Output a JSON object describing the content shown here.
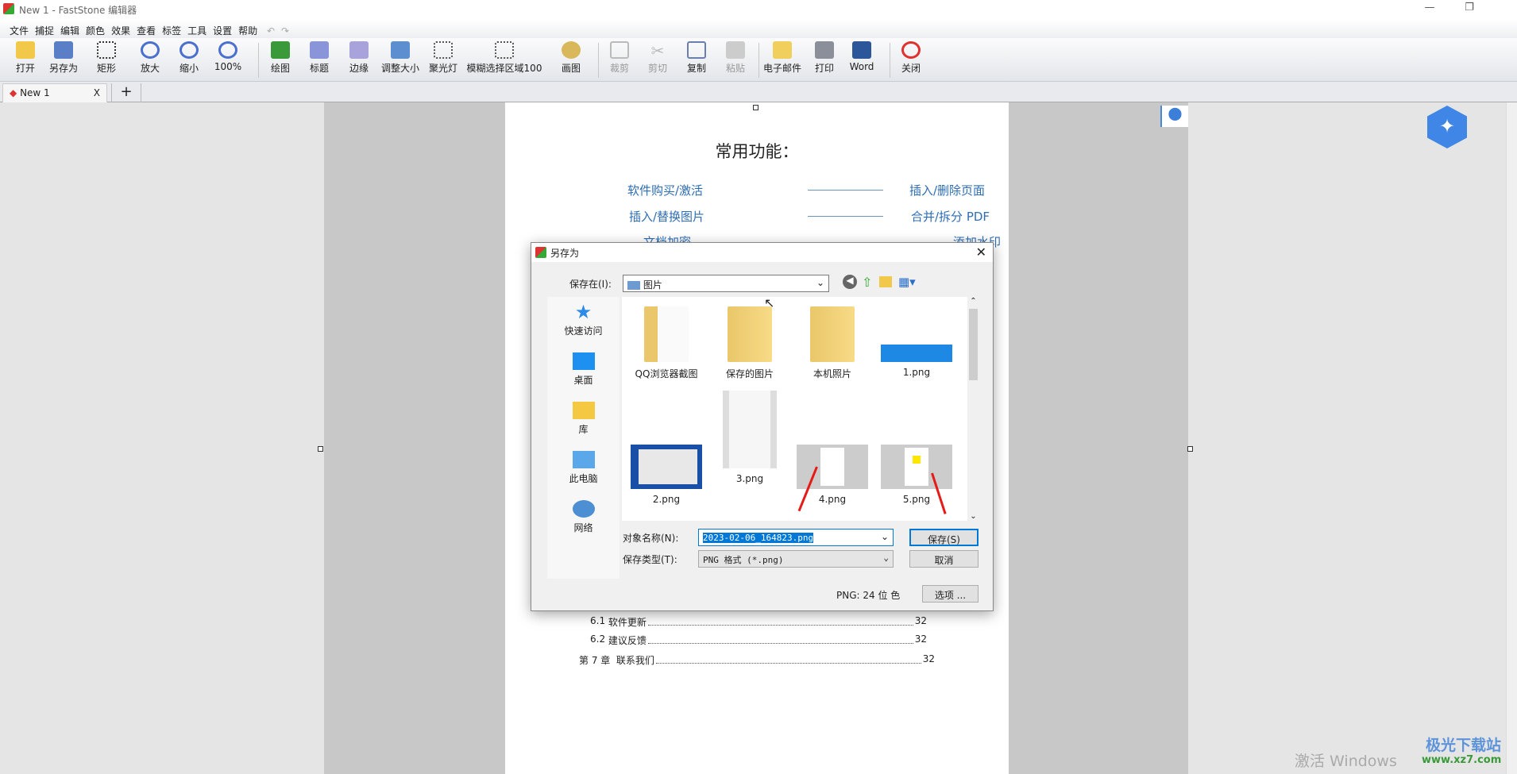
{
  "window": {
    "title": "New 1 - FastStone 编辑器",
    "min": "—",
    "restore": "❐"
  },
  "menu": [
    "文件",
    "捕捉",
    "编辑",
    "颜色",
    "效果",
    "查看",
    "标签",
    "工具",
    "设置",
    "帮助"
  ],
  "toolbar": {
    "open": "打开",
    "save_as": "另存为",
    "rect": "矩形",
    "zoom_in": "放大",
    "zoom_out": "缩小",
    "zoom": "100%",
    "draw": "绘图",
    "caption": "标题",
    "edge": "边缘",
    "resize": "调整大小",
    "spotlight": "聚光灯",
    "blur": "模糊选择区域100",
    "paint": "画图",
    "crop": "裁剪",
    "cut": "剪切",
    "copy": "复制",
    "paste": "粘贴",
    "email": "电子邮件",
    "print": "打印",
    "word": "Word",
    "close": "关闭"
  },
  "tabs": [
    {
      "label": "New 1",
      "close": "X"
    }
  ],
  "add_tab": "+",
  "document": {
    "heading": "常用功能：",
    "links": [
      {
        "left": "软件购买/激活",
        "right": "插入/删除页面"
      },
      {
        "left": "插入/替换图片",
        "right": "合并/拆分 PDF"
      },
      {
        "left": "文档加密",
        "right": "添加水印"
      }
    ],
    "toc": [
      {
        "num": "6.1",
        "title": "软件更新",
        "page": "32"
      },
      {
        "num": "6.2",
        "title": "建议反馈",
        "page": "32"
      },
      {
        "num": "第 7 章",
        "title": "联系我们",
        "page": "32"
      }
    ]
  },
  "dialog": {
    "title": "另存为",
    "close": "✕",
    "save_in_label": "保存在(I):",
    "save_in_value": "图片",
    "places": [
      "快速访问",
      "桌面",
      "库",
      "此电脑",
      "网络"
    ],
    "files": [
      "QQ浏览器截图",
      "保存的图片",
      "本机照片",
      "1.png",
      "2.png",
      "3.png",
      "4.png",
      "5.png"
    ],
    "name_label": "对象名称(N):",
    "name_value": "2023-02-06_164823.png",
    "type_label": "保存类型(T):",
    "type_value": "PNG 格式 (*.png)",
    "save": "保存(S)",
    "cancel": "取消",
    "color_info": "PNG: 24 位 色",
    "options": "选项 ..."
  },
  "watermark": {
    "activate": "激活 Windows",
    "site": "极光下载站",
    "url": "www.xz7.com"
  },
  "colors": {
    "accent": "#0078d7",
    "link": "#2e6db4",
    "arrow": "#e41b17"
  }
}
